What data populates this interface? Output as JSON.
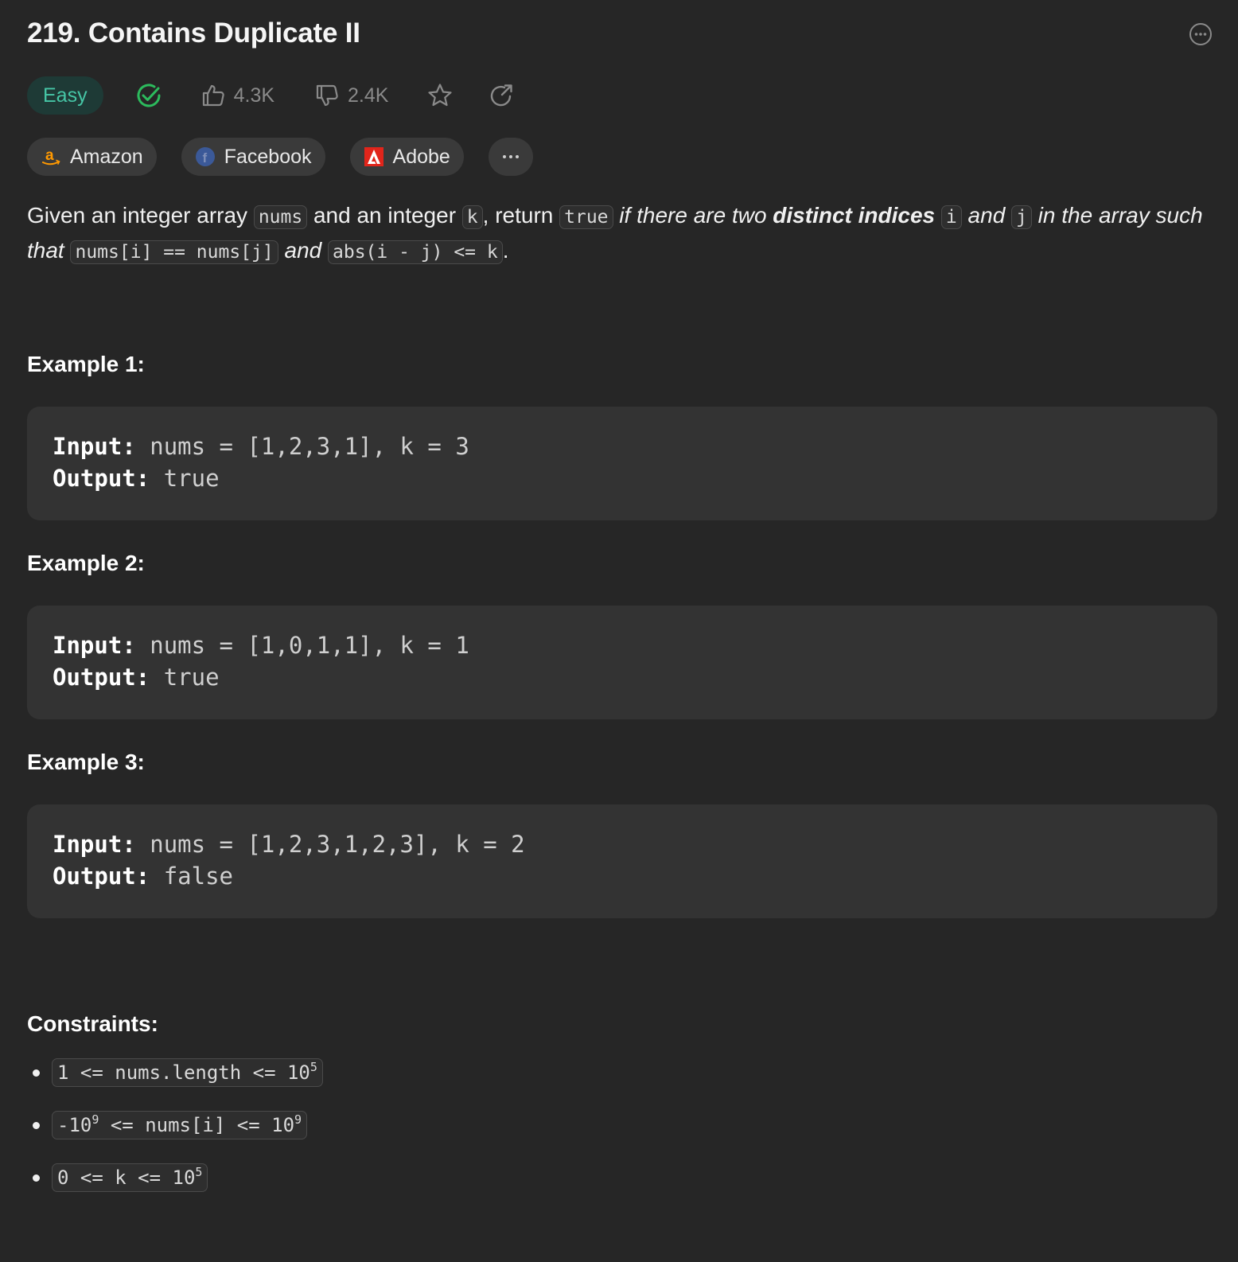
{
  "problem": {
    "title": "219. Contains Duplicate II",
    "difficulty": "Easy",
    "likes": "4.3K",
    "dislikes": "2.4K"
  },
  "tags": [
    {
      "label": "Amazon"
    },
    {
      "label": "Facebook"
    },
    {
      "label": "Adobe"
    }
  ],
  "description": {
    "p1": "Given an integer array ",
    "c_nums": "nums",
    "p2": " and an integer ",
    "c_k": "k",
    "p3": ", return ",
    "c_true": "true",
    "p4": " if there are two ",
    "p5": "distinct indices",
    "c_i": "i",
    "p6": " and ",
    "c_j": "j",
    "p7": " in the array such that ",
    "c_eq": "nums[i] == nums[j]",
    "p8": " and ",
    "c_abs": "abs(i - j) <= k",
    "p9": "."
  },
  "examples": [
    {
      "heading": "Example 1:",
      "input_label": "Input:",
      "input": "nums = [1,2,3,1], k = 3",
      "output_label": "Output:",
      "output": "true"
    },
    {
      "heading": "Example 2:",
      "input_label": "Input:",
      "input": "nums = [1,0,1,1], k = 1",
      "output_label": "Output:",
      "output": "true"
    },
    {
      "heading": "Example 3:",
      "input_label": "Input:",
      "input": "nums = [1,2,3,1,2,3], k = 2",
      "output_label": "Output:",
      "output": "false"
    }
  ],
  "constraints": {
    "title": "Constraints:",
    "c1": {
      "pre": "1 <= nums.length <= 10",
      "exp": "5"
    },
    "c2": {
      "pre": "-10",
      "exp1": "9",
      "mid": " <= nums[i] <= 10",
      "exp2": "9"
    },
    "c3": {
      "pre": "0 <= k <= 10",
      "exp": "5"
    }
  },
  "colors": {
    "background": "#262626",
    "easy": "#46c6a6",
    "solved": "#2cbb5d",
    "code_box": "#333333"
  }
}
